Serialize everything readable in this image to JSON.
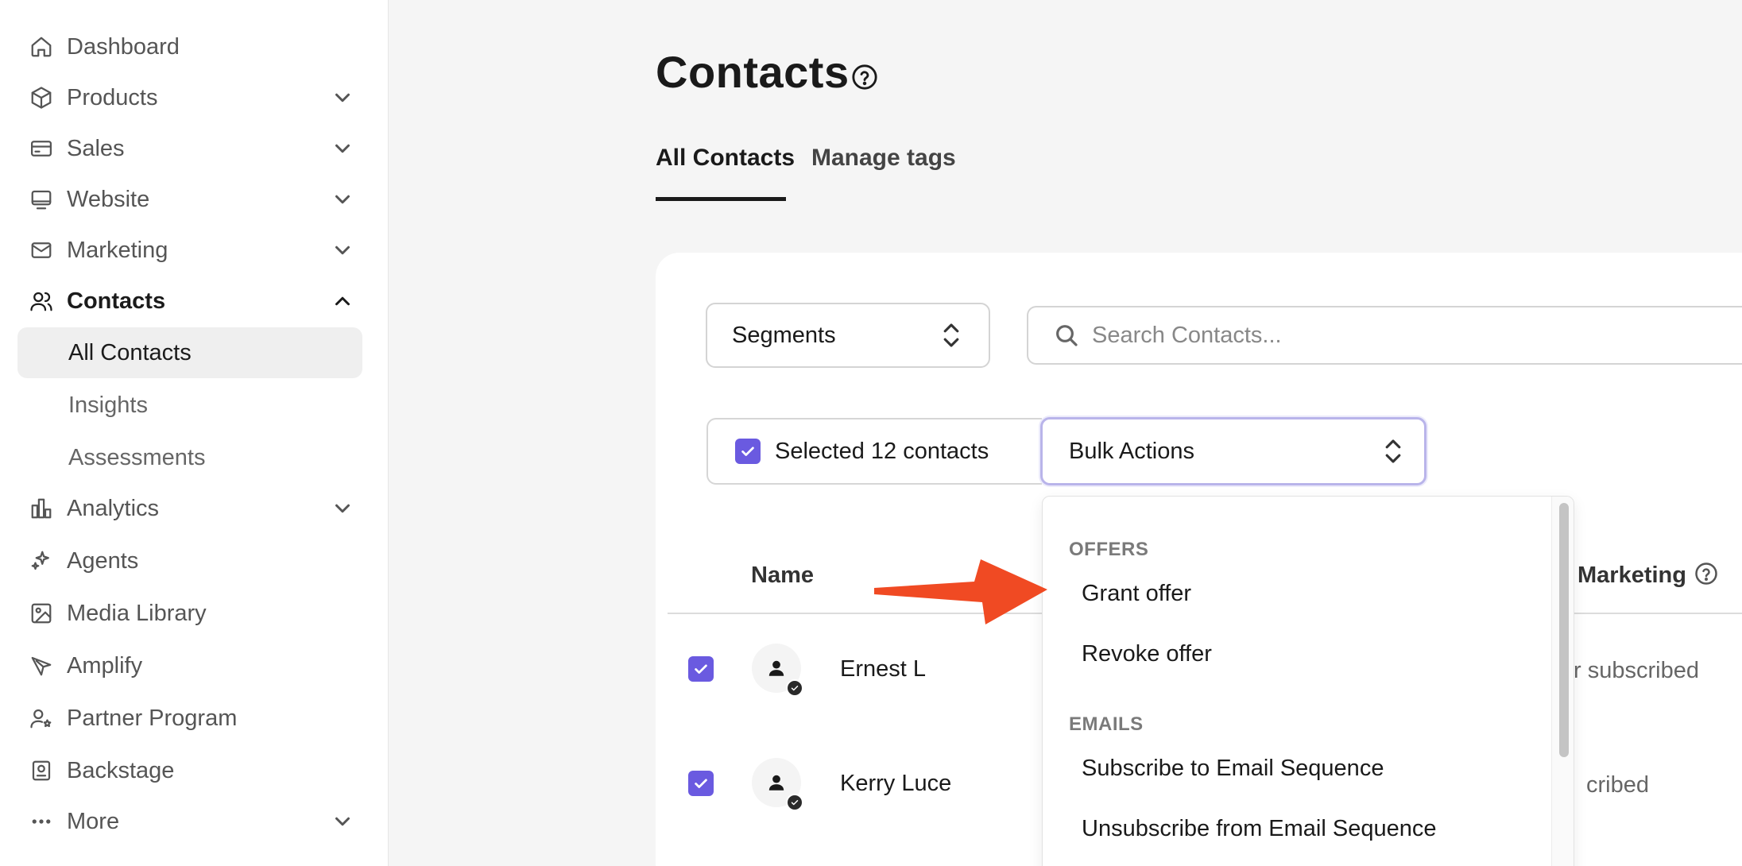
{
  "sidebar": {
    "items": [
      {
        "label": "Dashboard",
        "icon": "home-icon"
      },
      {
        "label": "Products",
        "icon": "box-icon"
      },
      {
        "label": "Sales",
        "icon": "credit-card-icon"
      },
      {
        "label": "Website",
        "icon": "monitor-icon"
      },
      {
        "label": "Marketing",
        "icon": "mail-icon"
      },
      {
        "label": "Contacts",
        "icon": "users-icon"
      },
      {
        "label": "Analytics",
        "icon": "bar-chart-icon"
      },
      {
        "label": "Agents",
        "icon": "sparkles-icon"
      },
      {
        "label": "Media Library",
        "icon": "image-icon"
      },
      {
        "label": "Amplify",
        "icon": "send-icon"
      },
      {
        "label": "Partner Program",
        "icon": "user-star-icon"
      },
      {
        "label": "Backstage",
        "icon": "badge-icon"
      },
      {
        "label": "More",
        "icon": "more-dots-icon"
      }
    ],
    "contacts_sub": [
      {
        "label": "All Contacts"
      },
      {
        "label": "Insights"
      },
      {
        "label": "Assessments"
      }
    ]
  },
  "main": {
    "title": "Contacts",
    "tabs": [
      {
        "label": "All Contacts"
      },
      {
        "label": "Manage tags"
      }
    ],
    "segments_label": "Segments",
    "search_placeholder": "Search Contacts...",
    "selected_label": "Selected 12 contacts",
    "bulk_label": "Bulk Actions",
    "columns": {
      "name": "Name",
      "marketing": "Marketing"
    },
    "rows": [
      {
        "name": "Ernest L",
        "status": "r subscribed"
      },
      {
        "name": "Kerry Luce",
        "status": "cribed"
      }
    ]
  },
  "dropdown": {
    "groups": [
      {
        "label": "OFFERS",
        "items": [
          "Grant offer",
          "Revoke offer"
        ]
      },
      {
        "label": "EMAILS",
        "items": [
          "Subscribe to Email Sequence",
          "Unsubscribe from Email Sequence"
        ]
      }
    ]
  },
  "colors": {
    "accent": "#6a5ae0",
    "arrow": "#f04a23",
    "focus_border": "#b9b4ea"
  }
}
